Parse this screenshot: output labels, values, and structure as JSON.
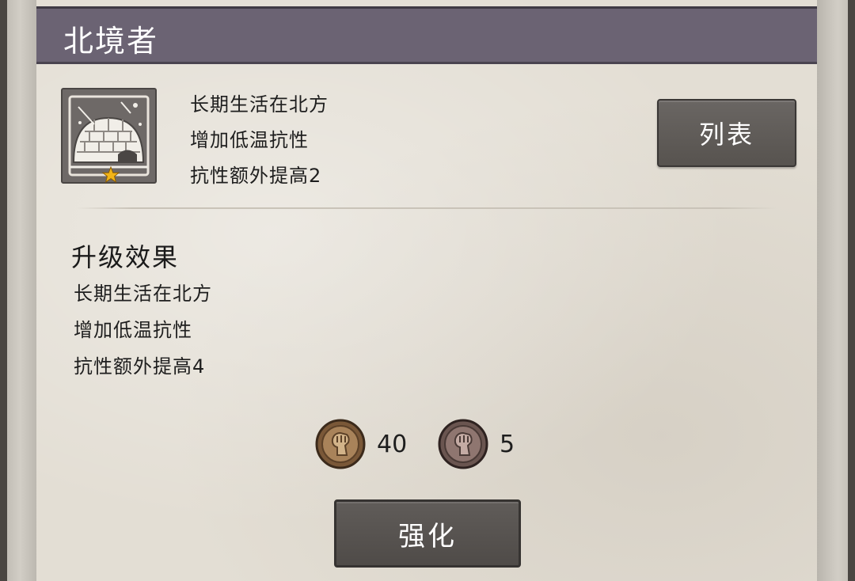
{
  "header": {
    "title": "北境者"
  },
  "trait": {
    "icon": "igloo-icon",
    "star_icon": "star-icon",
    "lines": [
      "长期生活在北方",
      "增加低温抗性",
      "抗性额外提高2"
    ]
  },
  "actions": {
    "list_label": "列表",
    "upgrade_label": "强化"
  },
  "upgrade": {
    "heading": "升级效果",
    "lines": [
      "长期生活在北方",
      "增加低温抗性",
      "抗性额外提高4"
    ]
  },
  "costs": [
    {
      "icon": "fist-medal-bronze-icon",
      "amount": "40"
    },
    {
      "icon": "fist-medal-dark-icon",
      "amount": "5"
    }
  ],
  "colors": {
    "title_bar": "#6b6373",
    "paper": "#e3ded4",
    "button": "#5a5653"
  }
}
